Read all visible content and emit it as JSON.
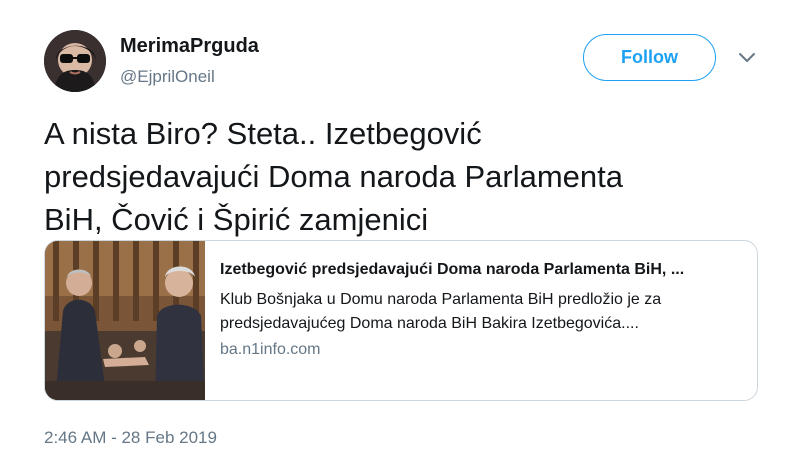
{
  "user": {
    "display_name": "MerimaPrguda",
    "handle": "@EjprilOneil"
  },
  "actions": {
    "follow_label": "Follow"
  },
  "tweet": {
    "text": "A nista Biro? Steta.. Izetbegović\npredsjedavajući Doma naroda Parlamenta\nBiH, Čović i Špirić zamjenici",
    "timestamp": "2:46 AM - 28 Feb 2019"
  },
  "card": {
    "title": "Izetbegović predsjedavajući Doma naroda Parlamenta BiH, ...",
    "description": "Klub Bošnjaka u Domu naroda Parlamenta BiH predložio je za predsjedavajućeg Doma naroda BiH Bakira Izetbegovića....",
    "domain": "ba.n1info.com"
  },
  "colors": {
    "accent": "#1da1f2",
    "text": "#14171a",
    "muted": "#657786",
    "border": "#ccd6dd"
  },
  "icons": {
    "caret": "chevron-down-icon"
  }
}
